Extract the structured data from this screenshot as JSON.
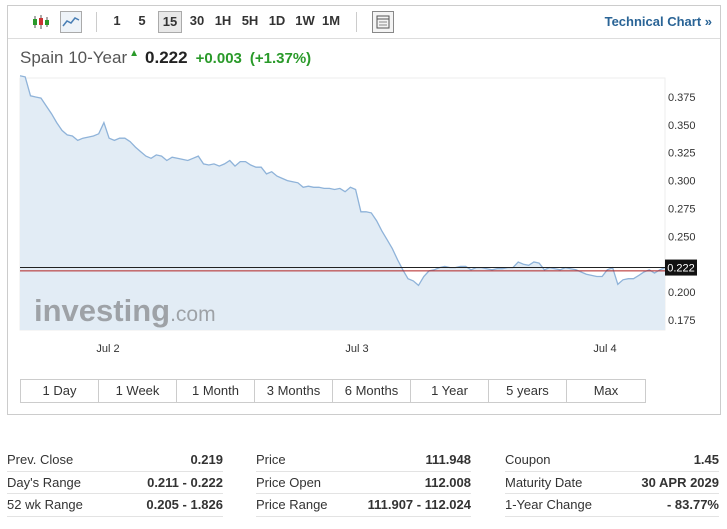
{
  "toolbar": {
    "candle_icon": "candlestick-icon",
    "area_icon": "area-chart-icon",
    "timeframes": [
      "1",
      "5",
      "15",
      "30",
      "1H",
      "5H",
      "1D",
      "1W",
      "1M"
    ],
    "active_timeframe": "15",
    "table_icon": "table-icon",
    "technical_chart": "Technical Chart »"
  },
  "instrument": {
    "name": "Spain 10-Year",
    "direction_icon": "up-arrow-icon",
    "price": "0.222",
    "change": "+0.003",
    "change_pct": "(+1.37%)"
  },
  "chart_data": {
    "type": "area",
    "x_tick_labels": [
      "Jul 2",
      "Jul 3",
      "Jul 4"
    ],
    "y_tick_labels": [
      "0.375",
      "0.350",
      "0.325",
      "0.300",
      "0.275",
      "0.250",
      "0.200",
      "0.175"
    ],
    "ylim": [
      0.166,
      0.392
    ],
    "last_price_label": "0.222",
    "prev_close": 0.219,
    "watermark": "investing.com",
    "values": [
      0.394,
      0.393,
      0.376,
      0.375,
      0.374,
      0.367,
      0.36,
      0.352,
      0.345,
      0.341,
      0.34,
      0.336,
      0.338,
      0.339,
      0.34,
      0.342,
      0.352,
      0.338,
      0.336,
      0.338,
      0.338,
      0.335,
      0.33,
      0.326,
      0.322,
      0.32,
      0.323,
      0.322,
      0.318,
      0.321,
      0.32,
      0.319,
      0.318,
      0.32,
      0.322,
      0.315,
      0.314,
      0.315,
      0.313,
      0.315,
      0.318,
      0.313,
      0.317,
      0.317,
      0.314,
      0.312,
      0.312,
      0.306,
      0.308,
      0.304,
      0.302,
      0.3,
      0.299,
      0.298,
      0.294,
      0.295,
      0.294,
      0.294,
      0.293,
      0.293,
      0.292,
      0.293,
      0.29,
      0.294,
      0.292,
      0.272,
      0.272,
      0.271,
      0.264,
      0.255,
      0.247,
      0.239,
      0.229,
      0.22,
      0.212,
      0.21,
      0.206,
      0.214,
      0.219,
      0.22,
      0.222,
      0.223,
      0.222,
      0.222,
      0.223,
      0.223,
      0.22,
      0.222,
      0.222,
      0.221,
      0.22,
      0.221,
      0.221,
      0.222,
      0.222,
      0.227,
      0.225,
      0.224,
      0.227,
      0.226,
      0.22,
      0.222,
      0.221,
      0.22,
      0.222,
      0.221,
      0.22,
      0.218,
      0.216,
      0.215,
      0.214,
      0.214,
      0.22,
      0.222,
      0.207,
      0.211,
      0.212,
      0.212,
      0.215,
      0.218,
      0.22,
      0.217,
      0.22,
      0.222
    ]
  },
  "ranges": [
    "1 Day",
    "1 Week",
    "1 Month",
    "3 Months",
    "6 Months",
    "1 Year",
    "5 years",
    "Max"
  ],
  "stats": [
    [
      {
        "label": "Prev. Close",
        "value": "0.219"
      },
      {
        "label": "Day's Range",
        "value": "0.211 - 0.222"
      },
      {
        "label": "52 wk Range",
        "value": "0.205 - 1.826"
      }
    ],
    [
      {
        "label": "Price",
        "value": "111.948"
      },
      {
        "label": "Price Open",
        "value": "112.008"
      },
      {
        "label": "Price Range",
        "value": "111.907 - 112.024"
      }
    ],
    [
      {
        "label": "Coupon",
        "value": "1.45"
      },
      {
        "label": "Maturity Date",
        "value": "30 APR 2029"
      },
      {
        "label": "1-Year Change",
        "value": "- 83.77%"
      }
    ]
  ],
  "colors": {
    "accent": "#2a6496",
    "positive": "#2a9a2a",
    "line": "#8fb3d9",
    "area": "#e2ecf5",
    "prev_close_line": "#b22222"
  }
}
